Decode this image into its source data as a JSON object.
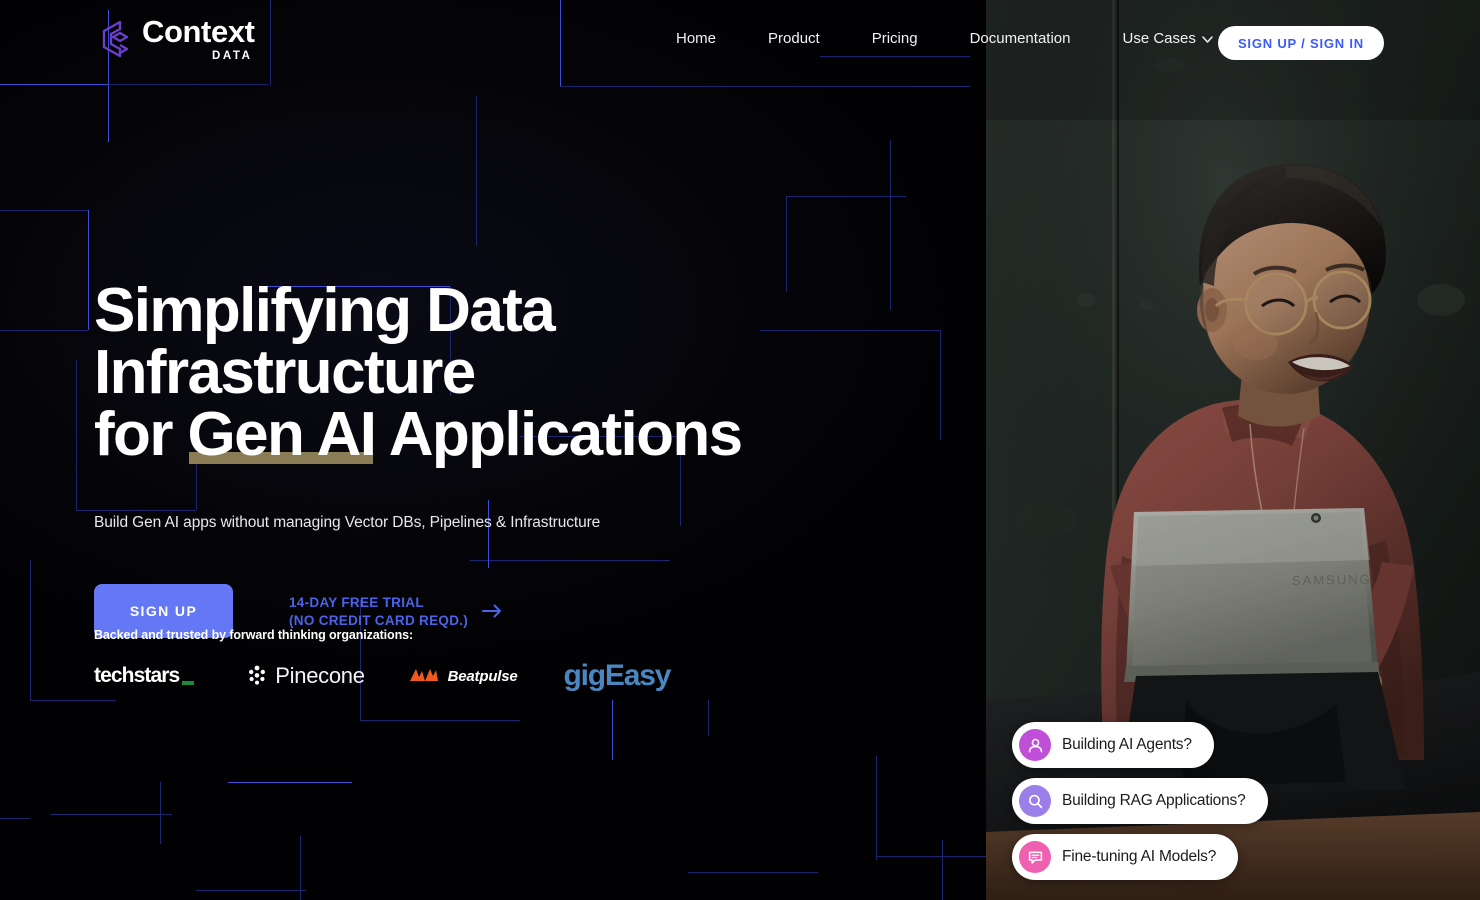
{
  "brand": {
    "name": "Context",
    "sub": "DATA",
    "logo_icon": "context-c-logo-icon",
    "logo_color": "#6B3FC9"
  },
  "nav": {
    "items": [
      {
        "label": "Home",
        "has_caret": false
      },
      {
        "label": "Product",
        "has_caret": false
      },
      {
        "label": "Pricing",
        "has_caret": false
      },
      {
        "label": "Documentation",
        "has_caret": false
      },
      {
        "label": "Use Cases",
        "has_caret": true
      }
    ],
    "caret_icon": "chevron-down-icon",
    "auth_button": "SIGN UP / SIGN IN",
    "auth_button_bg": "#FFFFFF",
    "auth_button_fg": "#3B5BFD"
  },
  "hero": {
    "headline_line1": "Simplifying Data Infrastructure",
    "headline_line2_pre": "for ",
    "headline_line2_highlight": "Gen AI",
    "headline_line2_post": " Applications",
    "highlight_color": "#8A7D55",
    "subheadline": "Build Gen AI apps without managing Vector DBs, Pipelines & Infrastructure",
    "cta_primary": "SIGN UP",
    "cta_primary_bg": "#6478F5",
    "trial_line1": "14-DAY FREE TRIAL",
    "trial_line2": "(NO CREDIT CARD REQD.)",
    "trial_color": "#4A63E8",
    "trial_arrow_icon": "arrow-right-icon"
  },
  "backers": {
    "label": "Backed and trusted by forward thinking organizations:",
    "logos": [
      {
        "name": "techstars",
        "icon": "techstars-logo",
        "accent": "#1F8A3C"
      },
      {
        "name": "Pinecone",
        "icon": "pinecone-logo",
        "accent": "#FFFFFF"
      },
      {
        "name": "Beatpulse",
        "icon": "beatpulse-logo",
        "accent": "#F15A1E"
      },
      {
        "name": "gigEasy",
        "icon": "gigeasy-logo",
        "accent": "#4A86C0"
      }
    ]
  },
  "photo": {
    "alt": "Smiling person with glasses in a rust red sweater using a silver Samsung laptop against a dark green concrete wall",
    "subject_sweater_color": "#8E4A44",
    "wall_color": "#2C3330"
  },
  "chips": [
    {
      "label": "Building AI Agents?",
      "icon": "user-icon",
      "icon_bg": "#C04FD8"
    },
    {
      "label": "Building RAG Applications?",
      "icon": "search-icon",
      "icon_bg": "#9B7EE8"
    },
    {
      "label": "Fine-tuning AI Models?",
      "icon": "chat-bubble-icon",
      "icon_bg": "#F060B0"
    }
  ],
  "background": {
    "base_color": "#010103",
    "circuit_line_color": "#2B3AA0"
  }
}
